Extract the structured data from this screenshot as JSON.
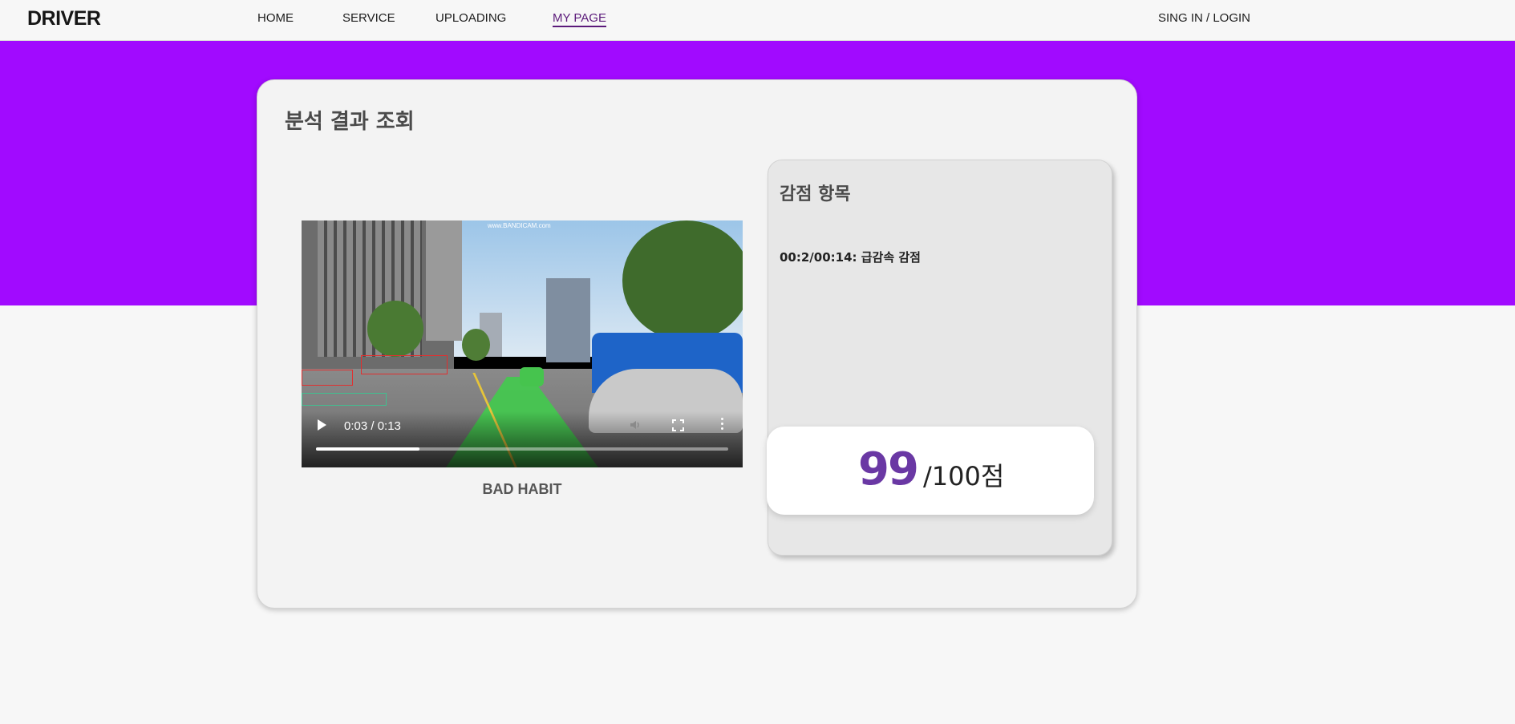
{
  "header": {
    "logo": "DRIVER",
    "nav": [
      {
        "label": "HOME"
      },
      {
        "label": "SERVICE"
      },
      {
        "label": "UPLOADING"
      },
      {
        "label": "MY PAGE",
        "active": true
      }
    ],
    "login": "SING IN / LOGIN"
  },
  "colors": {
    "accent_band": "#a10aff",
    "score_number": "#6a38a4",
    "active_nav": "#5b1a7a"
  },
  "main": {
    "title": "분석 결과 조회",
    "video": {
      "watermark": "www.BANDICAM.com",
      "time": "0:03 / 0:13",
      "progress_fraction": 0.25,
      "caption": "BAD HABIT",
      "icons": [
        "play-icon",
        "volume-icon",
        "fullscreen-icon",
        "more-options-icon"
      ]
    },
    "deductions": {
      "title": "감점 항목",
      "items": [
        "00:2/00:14: 급감속 감점"
      ]
    },
    "score": {
      "value": "99",
      "suffix": "/100점"
    }
  }
}
